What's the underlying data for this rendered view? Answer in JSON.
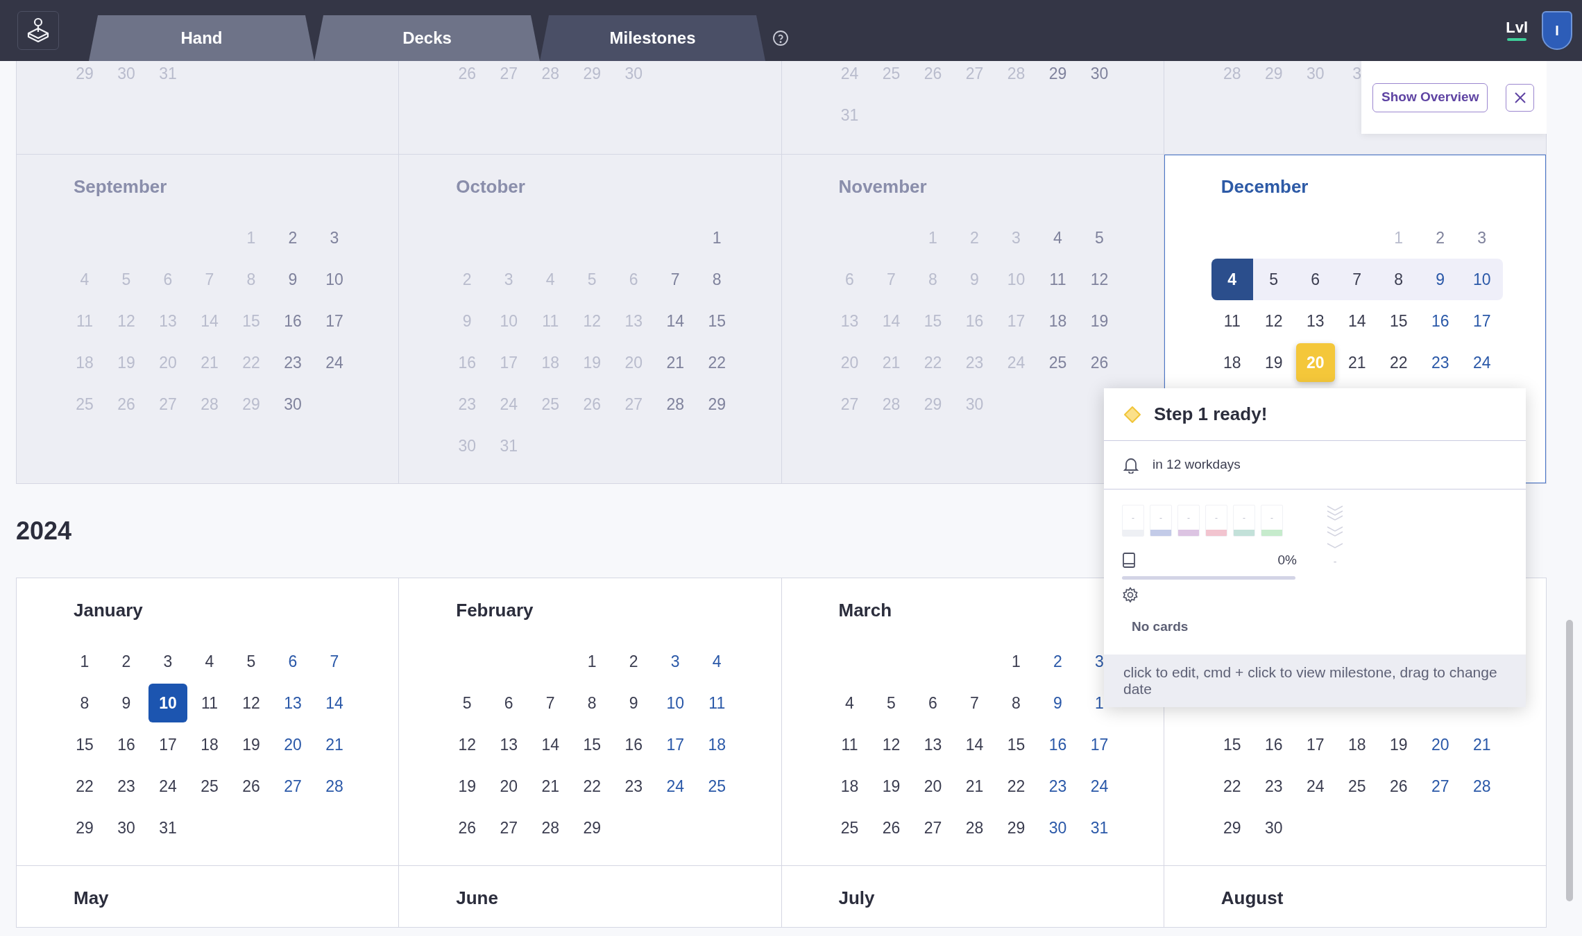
{
  "tabs": [
    {
      "label": "Hand",
      "selected": false
    },
    {
      "label": "Decks",
      "selected": false
    },
    {
      "label": "Milestones",
      "selected": true
    }
  ],
  "level": {
    "label": "Lvl",
    "level": 1,
    "badge": "I"
  },
  "overview": {
    "button": "Show Overview"
  },
  "top_months": [
    {
      "past": true,
      "selected": false,
      "weeks": [
        [
          {
            "d": "29",
            "kind": "past"
          },
          {
            "d": "30",
            "kind": "past"
          },
          {
            "d": "31",
            "kind": "past"
          }
        ]
      ]
    },
    {
      "past": true,
      "selected": false,
      "weeks": [
        [
          {
            "d": "26",
            "kind": "past"
          },
          {
            "d": "27",
            "kind": "past"
          },
          {
            "d": "28",
            "kind": "past"
          },
          {
            "d": "29",
            "kind": "past"
          },
          {
            "d": "30",
            "kind": "past"
          }
        ]
      ]
    },
    {
      "past": true,
      "selected": false,
      "weeks": [
        [
          {
            "d": "24",
            "kind": "past"
          },
          {
            "d": "25",
            "kind": "past"
          },
          {
            "d": "26",
            "kind": "past"
          },
          {
            "d": "27",
            "kind": "past"
          },
          {
            "d": "28",
            "kind": "past"
          },
          {
            "d": "29",
            "kind": "past"
          },
          {
            "d": "30",
            "kind": "past"
          }
        ],
        [
          {
            "d": "31",
            "kind": "past"
          }
        ]
      ]
    },
    {
      "past": true,
      "selected": false,
      "weeks": [
        [
          {
            "d": "28",
            "kind": "past"
          },
          {
            "d": "29",
            "kind": "past"
          },
          {
            "d": "30",
            "kind": "past"
          },
          {
            "d": "3",
            "kind": "past"
          }
        ]
      ]
    }
  ],
  "months_2023": [
    {
      "name": "September",
      "past": true,
      "selected": false,
      "weeks": [
        [
          {
            "kind": "blank"
          },
          {
            "kind": "blank"
          },
          {
            "kind": "blank"
          },
          {
            "kind": "blank"
          },
          {
            "d": "1",
            "kind": "past"
          },
          {
            "d": "2",
            "kind": "past"
          },
          {
            "d": "3",
            "kind": "past"
          }
        ],
        [
          {
            "d": "4",
            "kind": "past"
          },
          {
            "d": "5",
            "kind": "past"
          },
          {
            "d": "6",
            "kind": "past"
          },
          {
            "d": "7",
            "kind": "past"
          },
          {
            "d": "8",
            "kind": "past"
          },
          {
            "d": "9",
            "kind": "past"
          },
          {
            "d": "10",
            "kind": "past"
          }
        ],
        [
          {
            "d": "11",
            "kind": "past"
          },
          {
            "d": "12",
            "kind": "past"
          },
          {
            "d": "13",
            "kind": "past"
          },
          {
            "d": "14",
            "kind": "past"
          },
          {
            "d": "15",
            "kind": "past"
          },
          {
            "d": "16",
            "kind": "past"
          },
          {
            "d": "17",
            "kind": "past"
          }
        ],
        [
          {
            "d": "18",
            "kind": "past"
          },
          {
            "d": "19",
            "kind": "past"
          },
          {
            "d": "20",
            "kind": "past"
          },
          {
            "d": "21",
            "kind": "past"
          },
          {
            "d": "22",
            "kind": "past"
          },
          {
            "d": "23",
            "kind": "past"
          },
          {
            "d": "24",
            "kind": "past"
          }
        ],
        [
          {
            "d": "25",
            "kind": "past"
          },
          {
            "d": "26",
            "kind": "past"
          },
          {
            "d": "27",
            "kind": "past"
          },
          {
            "d": "28",
            "kind": "past"
          },
          {
            "d": "29",
            "kind": "past"
          },
          {
            "d": "30",
            "kind": "past"
          }
        ]
      ]
    },
    {
      "name": "October",
      "past": true,
      "selected": false,
      "weeks": [
        [
          {
            "kind": "blank"
          },
          {
            "kind": "blank"
          },
          {
            "kind": "blank"
          },
          {
            "kind": "blank"
          },
          {
            "kind": "blank"
          },
          {
            "kind": "blank"
          },
          {
            "d": "1",
            "kind": "past"
          }
        ],
        [
          {
            "d": "2",
            "kind": "past"
          },
          {
            "d": "3",
            "kind": "past"
          },
          {
            "d": "4",
            "kind": "past"
          },
          {
            "d": "5",
            "kind": "past"
          },
          {
            "d": "6",
            "kind": "past"
          },
          {
            "d": "7",
            "kind": "past"
          },
          {
            "d": "8",
            "kind": "past"
          }
        ],
        [
          {
            "d": "9",
            "kind": "past"
          },
          {
            "d": "10",
            "kind": "past"
          },
          {
            "d": "11",
            "kind": "past"
          },
          {
            "d": "12",
            "kind": "past"
          },
          {
            "d": "13",
            "kind": "past"
          },
          {
            "d": "14",
            "kind": "past"
          },
          {
            "d": "15",
            "kind": "past"
          }
        ],
        [
          {
            "d": "16",
            "kind": "past"
          },
          {
            "d": "17",
            "kind": "past"
          },
          {
            "d": "18",
            "kind": "past"
          },
          {
            "d": "19",
            "kind": "past"
          },
          {
            "d": "20",
            "kind": "past"
          },
          {
            "d": "21",
            "kind": "past"
          },
          {
            "d": "22",
            "kind": "past"
          }
        ],
        [
          {
            "d": "23",
            "kind": "past"
          },
          {
            "d": "24",
            "kind": "past"
          },
          {
            "d": "25",
            "kind": "past"
          },
          {
            "d": "26",
            "kind": "past"
          },
          {
            "d": "27",
            "kind": "past"
          },
          {
            "d": "28",
            "kind": "past"
          },
          {
            "d": "29",
            "kind": "past"
          }
        ],
        [
          {
            "d": "30",
            "kind": "past"
          },
          {
            "d": "31",
            "kind": "past"
          }
        ]
      ]
    },
    {
      "name": "November",
      "past": true,
      "selected": false,
      "weeks": [
        [
          {
            "kind": "blank"
          },
          {
            "kind": "blank"
          },
          {
            "d": "1",
            "kind": "past"
          },
          {
            "d": "2",
            "kind": "past"
          },
          {
            "d": "3",
            "kind": "past"
          },
          {
            "d": "4",
            "kind": "past"
          },
          {
            "d": "5",
            "kind": "past"
          }
        ],
        [
          {
            "d": "6",
            "kind": "past"
          },
          {
            "d": "7",
            "kind": "past"
          },
          {
            "d": "8",
            "kind": "past"
          },
          {
            "d": "9",
            "kind": "past"
          },
          {
            "d": "10",
            "kind": "past"
          },
          {
            "d": "11",
            "kind": "past"
          },
          {
            "d": "12",
            "kind": "past"
          }
        ],
        [
          {
            "d": "13",
            "kind": "past"
          },
          {
            "d": "14",
            "kind": "past"
          },
          {
            "d": "15",
            "kind": "past"
          },
          {
            "d": "16",
            "kind": "past"
          },
          {
            "d": "17",
            "kind": "past"
          },
          {
            "d": "18",
            "kind": "past"
          },
          {
            "d": "19",
            "kind": "past"
          }
        ],
        [
          {
            "d": "20",
            "kind": "past"
          },
          {
            "d": "21",
            "kind": "past"
          },
          {
            "d": "22",
            "kind": "past"
          },
          {
            "d": "23",
            "kind": "past"
          },
          {
            "d": "24",
            "kind": "past"
          },
          {
            "d": "25",
            "kind": "past"
          },
          {
            "d": "26",
            "kind": "past"
          }
        ],
        [
          {
            "d": "27",
            "kind": "past"
          },
          {
            "d": "28",
            "kind": "past"
          },
          {
            "d": "29",
            "kind": "past"
          },
          {
            "d": "30",
            "kind": "past"
          }
        ]
      ]
    },
    {
      "name": "December",
      "past": false,
      "selected": true,
      "weeks": [
        [
          {
            "kind": "blank"
          },
          {
            "kind": "blank"
          },
          {
            "kind": "blank"
          },
          {
            "kind": "blank"
          },
          {
            "d": "1",
            "kind": "past"
          },
          {
            "d": "2",
            "kind": "past"
          },
          {
            "d": "3",
            "kind": "past"
          }
        ],
        [
          {
            "d": "4",
            "kind": "today"
          },
          {
            "d": "5",
            "kind": "this-week"
          },
          {
            "d": "6",
            "kind": "this-week"
          },
          {
            "d": "7",
            "kind": "this-week"
          },
          {
            "d": "8",
            "kind": "this-week"
          },
          {
            "d": "9",
            "kind": "this-week"
          },
          {
            "d": "10",
            "kind": "this-week"
          }
        ],
        [
          {
            "d": "11",
            "kind": "day"
          },
          {
            "d": "12",
            "kind": "day"
          },
          {
            "d": "13",
            "kind": "day"
          },
          {
            "d": "14",
            "kind": "day"
          },
          {
            "d": "15",
            "kind": "day"
          },
          {
            "d": "16",
            "kind": "day"
          },
          {
            "d": "17",
            "kind": "day"
          }
        ],
        [
          {
            "d": "18",
            "kind": "day"
          },
          {
            "d": "19",
            "kind": "day"
          },
          {
            "d": "20",
            "kind": "milestone"
          },
          {
            "d": "21",
            "kind": "day"
          },
          {
            "d": "22",
            "kind": "day"
          },
          {
            "d": "23",
            "kind": "day"
          },
          {
            "d": "24",
            "kind": "day"
          }
        ]
      ]
    }
  ],
  "year": "2024",
  "months_2024": [
    {
      "name": "January",
      "past": false,
      "selected": false,
      "weeks": [
        [
          {
            "d": "1",
            "kind": "day"
          },
          {
            "d": "2",
            "kind": "day"
          },
          {
            "d": "3",
            "kind": "day"
          },
          {
            "d": "4",
            "kind": "day"
          },
          {
            "d": "5",
            "kind": "day"
          },
          {
            "d": "6",
            "kind": "day"
          },
          {
            "d": "7",
            "kind": "day"
          }
        ],
        [
          {
            "d": "8",
            "kind": "day"
          },
          {
            "d": "9",
            "kind": "day"
          },
          {
            "d": "10",
            "kind": "marked"
          },
          {
            "d": "11",
            "kind": "day"
          },
          {
            "d": "12",
            "kind": "day"
          },
          {
            "d": "13",
            "kind": "day"
          },
          {
            "d": "14",
            "kind": "day"
          }
        ],
        [
          {
            "d": "15",
            "kind": "day"
          },
          {
            "d": "16",
            "kind": "day"
          },
          {
            "d": "17",
            "kind": "day"
          },
          {
            "d": "18",
            "kind": "day"
          },
          {
            "d": "19",
            "kind": "day"
          },
          {
            "d": "20",
            "kind": "day"
          },
          {
            "d": "21",
            "kind": "day"
          }
        ],
        [
          {
            "d": "22",
            "kind": "day"
          },
          {
            "d": "23",
            "kind": "day"
          },
          {
            "d": "24",
            "kind": "day"
          },
          {
            "d": "25",
            "kind": "day"
          },
          {
            "d": "26",
            "kind": "day"
          },
          {
            "d": "27",
            "kind": "day"
          },
          {
            "d": "28",
            "kind": "day"
          }
        ],
        [
          {
            "d": "29",
            "kind": "day"
          },
          {
            "d": "30",
            "kind": "day"
          },
          {
            "d": "31",
            "kind": "day"
          }
        ]
      ]
    },
    {
      "name": "February",
      "past": false,
      "selected": false,
      "weeks": [
        [
          {
            "kind": "blank"
          },
          {
            "kind": "blank"
          },
          {
            "kind": "blank"
          },
          {
            "d": "1",
            "kind": "day"
          },
          {
            "d": "2",
            "kind": "day"
          },
          {
            "d": "3",
            "kind": "day"
          },
          {
            "d": "4",
            "kind": "day"
          }
        ],
        [
          {
            "d": "5",
            "kind": "day"
          },
          {
            "d": "6",
            "kind": "day"
          },
          {
            "d": "7",
            "kind": "day"
          },
          {
            "d": "8",
            "kind": "day"
          },
          {
            "d": "9",
            "kind": "day"
          },
          {
            "d": "10",
            "kind": "day"
          },
          {
            "d": "11",
            "kind": "day"
          }
        ],
        [
          {
            "d": "12",
            "kind": "day"
          },
          {
            "d": "13",
            "kind": "day"
          },
          {
            "d": "14",
            "kind": "day"
          },
          {
            "d": "15",
            "kind": "day"
          },
          {
            "d": "16",
            "kind": "day"
          },
          {
            "d": "17",
            "kind": "day"
          },
          {
            "d": "18",
            "kind": "day"
          }
        ],
        [
          {
            "d": "19",
            "kind": "day"
          },
          {
            "d": "20",
            "kind": "day"
          },
          {
            "d": "21",
            "kind": "day"
          },
          {
            "d": "22",
            "kind": "day"
          },
          {
            "d": "23",
            "kind": "day"
          },
          {
            "d": "24",
            "kind": "day"
          },
          {
            "d": "25",
            "kind": "day"
          }
        ],
        [
          {
            "d": "26",
            "kind": "day"
          },
          {
            "d": "27",
            "kind": "day"
          },
          {
            "d": "28",
            "kind": "day"
          },
          {
            "d": "29",
            "kind": "day"
          }
        ]
      ]
    },
    {
      "name": "March",
      "past": false,
      "selected": false,
      "weeks": [
        [
          {
            "kind": "blank"
          },
          {
            "kind": "blank"
          },
          {
            "kind": "blank"
          },
          {
            "kind": "blank"
          },
          {
            "d": "1",
            "kind": "day"
          },
          {
            "d": "2",
            "kind": "day"
          },
          {
            "d": "3",
            "kind": "day"
          }
        ],
        [
          {
            "d": "4",
            "kind": "day"
          },
          {
            "d": "5",
            "kind": "day"
          },
          {
            "d": "6",
            "kind": "day"
          },
          {
            "d": "7",
            "kind": "day"
          },
          {
            "d": "8",
            "kind": "day"
          },
          {
            "d": "9",
            "kind": "day"
          },
          {
            "d": "1",
            "kind": "day"
          }
        ],
        [
          {
            "d": "11",
            "kind": "day"
          },
          {
            "d": "12",
            "kind": "day"
          },
          {
            "d": "13",
            "kind": "day"
          },
          {
            "d": "14",
            "kind": "day"
          },
          {
            "d": "15",
            "kind": "day"
          },
          {
            "d": "16",
            "kind": "day"
          },
          {
            "d": "17",
            "kind": "day"
          }
        ],
        [
          {
            "d": "18",
            "kind": "day"
          },
          {
            "d": "19",
            "kind": "day"
          },
          {
            "d": "20",
            "kind": "day"
          },
          {
            "d": "21",
            "kind": "day"
          },
          {
            "d": "22",
            "kind": "day"
          },
          {
            "d": "23",
            "kind": "day"
          },
          {
            "d": "24",
            "kind": "day"
          }
        ],
        [
          {
            "d": "25",
            "kind": "day"
          },
          {
            "d": "26",
            "kind": "day"
          },
          {
            "d": "27",
            "kind": "day"
          },
          {
            "d": "28",
            "kind": "day"
          },
          {
            "d": "29",
            "kind": "day"
          },
          {
            "d": "30",
            "kind": "day"
          },
          {
            "d": "31",
            "kind": "day"
          }
        ]
      ]
    },
    {
      "past": false,
      "selected": false,
      "covered": true,
      "weeks": [
        [
          {
            "d": "15",
            "kind": "day"
          },
          {
            "d": "16",
            "kind": "day"
          },
          {
            "d": "17",
            "kind": "day"
          },
          {
            "d": "18",
            "kind": "day"
          },
          {
            "d": "19",
            "kind": "day"
          },
          {
            "d": "20",
            "kind": "day"
          },
          {
            "d": "21",
            "kind": "day"
          }
        ],
        [
          {
            "d": "22",
            "kind": "day"
          },
          {
            "d": "23",
            "kind": "day"
          },
          {
            "d": "24",
            "kind": "day"
          },
          {
            "d": "25",
            "kind": "day"
          },
          {
            "d": "26",
            "kind": "day"
          },
          {
            "d": "27",
            "kind": "day"
          },
          {
            "d": "28",
            "kind": "day"
          }
        ],
        [
          {
            "d": "29",
            "kind": "day"
          },
          {
            "d": "30",
            "kind": "day"
          }
        ]
      ]
    }
  ],
  "bottom_months": [
    {
      "name": "May",
      "past": false,
      "selected": false
    },
    {
      "name": "June",
      "past": false,
      "selected": false
    },
    {
      "name": "July",
      "past": false,
      "selected": false
    },
    {
      "name": "August",
      "past": false,
      "selected": false
    }
  ],
  "milestone_popup": {
    "title": "Step 1 ready!",
    "due": "in 12 workdays",
    "tiles": [
      {
        "text": "-",
        "color": "#eef0f4"
      },
      {
        "text": "-",
        "color": "#c3cbe8"
      },
      {
        "text": "-",
        "color": "#dcc4e2"
      },
      {
        "text": "-",
        "color": "#f2c4cf"
      },
      {
        "text": "-",
        "color": "#c3e1d9"
      },
      {
        "text": "-",
        "color": "#c6ebcc"
      }
    ],
    "rank": "-",
    "progress": {
      "level": 0,
      "reading": "0%"
    },
    "empty": "No cards",
    "hint": "click to edit, cmd + click to view milestone, drag to change date"
  }
}
